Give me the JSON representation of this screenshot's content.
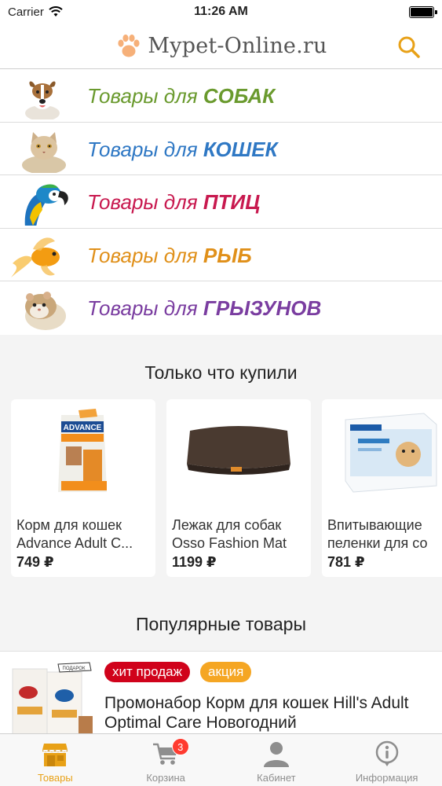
{
  "status_bar": {
    "carrier": "Carrier",
    "time": "11:26 AM",
    "battery_level": 1.0
  },
  "header": {
    "logo_text": "Mypet-Online.ru",
    "search_icon": "search-icon",
    "accent": "#e8a117"
  },
  "categories": [
    {
      "prefix": "Товары для ",
      "name": "СОБАК",
      "color": "#6a9a2e",
      "icon": "dog-image"
    },
    {
      "prefix": "Товары для ",
      "name": "КОШЕК",
      "color": "#2f78c4",
      "icon": "cat-image"
    },
    {
      "prefix": "Товары для ",
      "name": "ПТИЦ",
      "color": "#c8194f",
      "icon": "parrot-image"
    },
    {
      "prefix": "Товары для ",
      "name": "РЫБ",
      "color": "#e0901a",
      "icon": "goldfish-image"
    },
    {
      "prefix": "Товары для ",
      "name": "ГРЫЗУНОВ",
      "color": "#7a3da0",
      "icon": "hamster-image"
    }
  ],
  "recent": {
    "title": "Только что купили",
    "items": [
      {
        "name": "Корм для кошек Advance Adult C...",
        "price": "749 ₽",
        "image": "cat-food-bag"
      },
      {
        "name": "Лежак для собак Osso Fashion Mat",
        "price": "1199 ₽",
        "image": "dog-mat"
      },
      {
        "name": "Впитывающие пеленки для со",
        "price": "781 ₽",
        "image": "pads-pack"
      }
    ]
  },
  "popular": {
    "title": "Популярные товары",
    "items": [
      {
        "badges": [
          {
            "label": "хит продаж",
            "color": "#d0021b"
          },
          {
            "label": "акция",
            "color": "#f5a623"
          }
        ],
        "name": "Промонабор Корм для кошек Hill's Adult Optimal Care Новогодний",
        "image": "hills-promo-pack"
      }
    ]
  },
  "tabbar": {
    "tabs": [
      {
        "label": "Товары",
        "icon": "store-icon",
        "active": true
      },
      {
        "label": "Корзина",
        "icon": "cart-icon",
        "active": false,
        "badge": "3"
      },
      {
        "label": "Кабинет",
        "icon": "user-icon",
        "active": false
      },
      {
        "label": "Информация",
        "icon": "info-icon",
        "active": false
      }
    ]
  }
}
